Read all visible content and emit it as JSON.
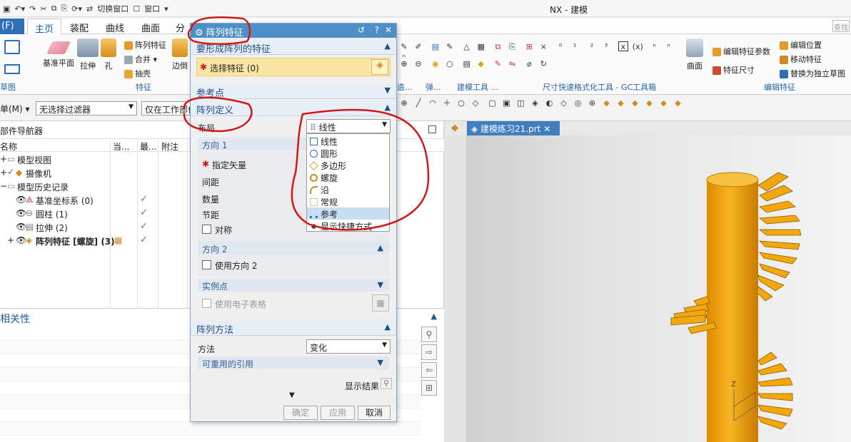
{
  "window_title": "NX - 建模",
  "quick_access": {
    "switch_window": "切换窗口",
    "window_menu": "窗口"
  },
  "ribbon": {
    "file_tab": "(F)",
    "tabs": [
      "主页",
      "装配",
      "曲线",
      "曲面",
      "分"
    ],
    "buttons": {
      "datum_plane": "基准平面",
      "extrude": "拉伸",
      "hole": "孔",
      "pattern_feature": "阵列特征",
      "combine": "合并",
      "shell": "抽壳",
      "edge_blend": "边倒",
      "surface": "曲面",
      "edit_feature_params": "编辑特征参数",
      "feature_dimensions": "特征尺寸",
      "edit_position": "编辑位置",
      "move_feature": "移动特征",
      "replace_sketch": "替换为独立草图"
    },
    "groups": {
      "sketch": "草图",
      "feature": "特征",
      "bom": "造...",
      "spring": "弹...",
      "modeling_tools": "建模工具 ...",
      "gc_toolbox": "尺寸快速格式化工具 - GC工具箱",
      "edit_feature": "编辑特征"
    },
    "search_placeholder": "查找"
  },
  "filter_bar": {
    "menu": "单(M)",
    "selection_filter": "无选择过滤器",
    "scope": "仅在工作部件"
  },
  "part_navigator": {
    "title": "部件导航器",
    "columns": [
      "名称",
      "当...",
      "最...",
      "附注"
    ],
    "rows": [
      {
        "label": "模型视图",
        "check": false
      },
      {
        "label": "摄像机",
        "check": false
      },
      {
        "label": "模型历史记录",
        "check": false
      },
      {
        "label": "基准坐标系 (0)",
        "check": true
      },
      {
        "label": "圆柱 (1)",
        "check": true
      },
      {
        "label": "拉伸 (2)",
        "check": true
      },
      {
        "label": "阵列特征 [螺旋] (3)",
        "check": true
      }
    ]
  },
  "dependencies": {
    "title": "相关性"
  },
  "dialog": {
    "title": "阵列特征",
    "sec_feature_to_pattern": "要形成阵列的特征",
    "select_feature": "选择特征 (0)",
    "sec_reference_point": "参考点",
    "sec_pattern_definition": "阵列定义",
    "layout_label": "布局",
    "layout_value": "线性",
    "direction1": "方向 1",
    "specify_vector": "指定矢量",
    "spacing": "间距",
    "count": "数量",
    "pitch": "节距",
    "symmetric": "对称",
    "direction2": "方向 2",
    "use_direction2": "使用方向 2",
    "instance_points": "实例点",
    "use_spreadsheet": "使用电子表格",
    "sec_pattern_method": "阵列方法",
    "method_label": "方法",
    "method_value": "变化",
    "reusable_refs": "可重用的引用",
    "show_result": "显示结果",
    "ok": "确定",
    "apply": "应用",
    "cancel": "取消"
  },
  "layout_options": [
    {
      "label": "线性",
      "selected": false
    },
    {
      "label": "圆形",
      "selected": false
    },
    {
      "label": "多边形",
      "selected": false
    },
    {
      "label": "螺旋",
      "selected": false
    },
    {
      "label": "沿",
      "selected": false
    },
    {
      "label": "常规",
      "selected": false
    },
    {
      "label": "参考",
      "selected": true
    },
    {
      "label": "显示快捷方式",
      "selected": false
    }
  ],
  "viewport": {
    "tab": "建模练习21.prt",
    "axis_z": "Z"
  },
  "colors": {
    "accent": "#2f6fb5",
    "dialog_title": "#4d8fc7",
    "model": "#f0a30a",
    "annotation": "#d01818",
    "check": "#2aa23a"
  }
}
